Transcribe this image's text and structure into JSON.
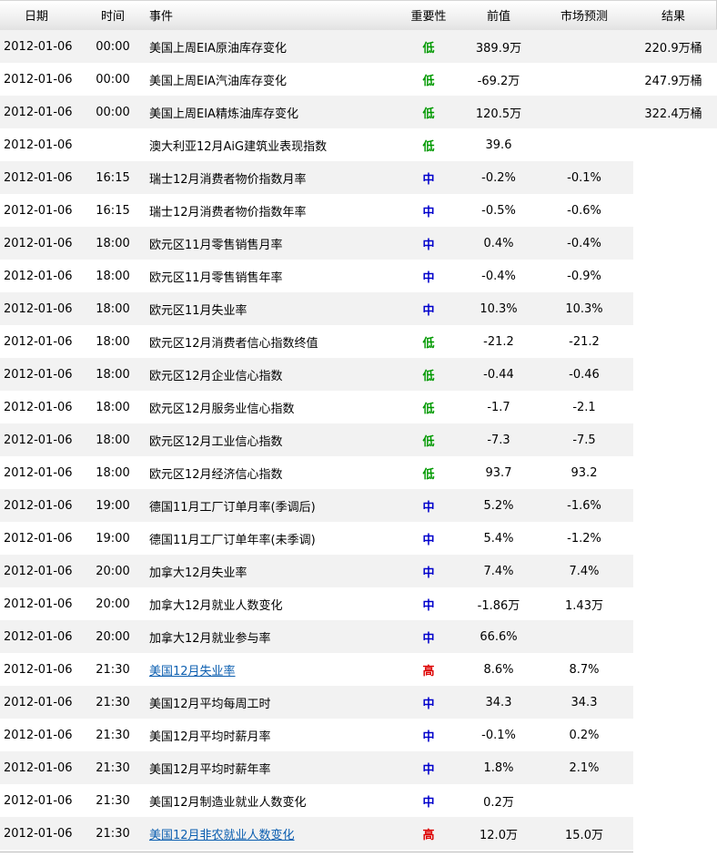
{
  "headers": {
    "date": "日期",
    "time": "时间",
    "event": "事件",
    "importance": "重要性",
    "previous": "前值",
    "forecast": "市场预测",
    "result": "结果"
  },
  "rows": [
    {
      "date": "2012-01-06",
      "time": "00:00",
      "event": "美国上周EIA原油库存变化",
      "importance": "低",
      "level": "low",
      "previous": "389.9万",
      "forecast": "",
      "result": "220.9万桶",
      "link": false
    },
    {
      "date": "2012-01-06",
      "time": "00:00",
      "event": "美国上周EIA汽油库存变化",
      "importance": "低",
      "level": "low",
      "previous": "-69.2万",
      "forecast": "",
      "result": "247.9万桶",
      "link": false
    },
    {
      "date": "2012-01-06",
      "time": "00:00",
      "event": "美国上周EIA精炼油库存变化",
      "importance": "低",
      "level": "low",
      "previous": "120.5万",
      "forecast": "",
      "result": "322.4万桶",
      "link": false
    },
    {
      "date": "2012-01-06",
      "time": "",
      "event": "澳大利亚12月AiG建筑业表现指数",
      "importance": "低",
      "level": "low",
      "previous": "39.6",
      "forecast": "",
      "result": "",
      "link": false
    },
    {
      "date": "2012-01-06",
      "time": "16:15",
      "event": "瑞士12月消费者物价指数月率",
      "importance": "中",
      "level": "mid",
      "previous": "-0.2%",
      "forecast": "-0.1%",
      "result": "",
      "link": false
    },
    {
      "date": "2012-01-06",
      "time": "16:15",
      "event": "瑞士12月消费者物价指数年率",
      "importance": "中",
      "level": "mid",
      "previous": "-0.5%",
      "forecast": "-0.6%",
      "result": "",
      "link": false
    },
    {
      "date": "2012-01-06",
      "time": "18:00",
      "event": "欧元区11月零售销售月率",
      "importance": "中",
      "level": "mid",
      "previous": "0.4%",
      "forecast": "-0.4%",
      "result": "",
      "link": false
    },
    {
      "date": "2012-01-06",
      "time": "18:00",
      "event": "欧元区11月零售销售年率",
      "importance": "中",
      "level": "mid",
      "previous": "-0.4%",
      "forecast": "-0.9%",
      "result": "",
      "link": false
    },
    {
      "date": "2012-01-06",
      "time": "18:00",
      "event": "欧元区11月失业率",
      "importance": "中",
      "level": "mid",
      "previous": "10.3%",
      "forecast": "10.3%",
      "result": "",
      "link": false
    },
    {
      "date": "2012-01-06",
      "time": "18:00",
      "event": "欧元区12月消费者信心指数终值",
      "importance": "低",
      "level": "low",
      "previous": "-21.2",
      "forecast": "-21.2",
      "result": "",
      "link": false
    },
    {
      "date": "2012-01-06",
      "time": "18:00",
      "event": "欧元区12月企业信心指数",
      "importance": "低",
      "level": "low",
      "previous": "-0.44",
      "forecast": "-0.46",
      "result": "",
      "link": false
    },
    {
      "date": "2012-01-06",
      "time": "18:00",
      "event": "欧元区12月服务业信心指数",
      "importance": "低",
      "level": "low",
      "previous": "-1.7",
      "forecast": "-2.1",
      "result": "",
      "link": false
    },
    {
      "date": "2012-01-06",
      "time": "18:00",
      "event": "欧元区12月工业信心指数",
      "importance": "低",
      "level": "low",
      "previous": "-7.3",
      "forecast": "-7.5",
      "result": "",
      "link": false
    },
    {
      "date": "2012-01-06",
      "time": "18:00",
      "event": "欧元区12月经济信心指数",
      "importance": "低",
      "level": "low",
      "previous": "93.7",
      "forecast": "93.2",
      "result": "",
      "link": false
    },
    {
      "date": "2012-01-06",
      "time": "19:00",
      "event": "德国11月工厂订单月率(季调后)",
      "importance": "中",
      "level": "mid",
      "previous": "5.2%",
      "forecast": "-1.6%",
      "result": "",
      "link": false
    },
    {
      "date": "2012-01-06",
      "time": "19:00",
      "event": "德国11月工厂订单年率(未季调)",
      "importance": "中",
      "level": "mid",
      "previous": "5.4%",
      "forecast": "-1.2%",
      "result": "",
      "link": false
    },
    {
      "date": "2012-01-06",
      "time": "20:00",
      "event": "加拿大12月失业率",
      "importance": "中",
      "level": "mid",
      "previous": "7.4%",
      "forecast": "7.4%",
      "result": "",
      "link": false
    },
    {
      "date": "2012-01-06",
      "time": "20:00",
      "event": "加拿大12月就业人数变化",
      "importance": "中",
      "level": "mid",
      "previous": "-1.86万",
      "forecast": "1.43万",
      "result": "",
      "link": false
    },
    {
      "date": "2012-01-06",
      "time": "20:00",
      "event": "加拿大12月就业参与率",
      "importance": "中",
      "level": "mid",
      "previous": "66.6%",
      "forecast": "",
      "result": "",
      "link": false
    },
    {
      "date": "2012-01-06",
      "time": "21:30",
      "event": "美国12月失业率",
      "importance": "高",
      "level": "high",
      "previous": "8.6%",
      "forecast": "8.7%",
      "result": "",
      "link": true
    },
    {
      "date": "2012-01-06",
      "time": "21:30",
      "event": "美国12月平均每周工时",
      "importance": "中",
      "level": "mid",
      "previous": "34.3",
      "forecast": "34.3",
      "result": "",
      "link": false
    },
    {
      "date": "2012-01-06",
      "time": "21:30",
      "event": "美国12月平均时薪月率",
      "importance": "中",
      "level": "mid",
      "previous": "-0.1%",
      "forecast": "0.2%",
      "result": "",
      "link": false
    },
    {
      "date": "2012-01-06",
      "time": "21:30",
      "event": "美国12月平均时薪年率",
      "importance": "中",
      "level": "mid",
      "previous": "1.8%",
      "forecast": "2.1%",
      "result": "",
      "link": false
    },
    {
      "date": "2012-01-06",
      "time": "21:30",
      "event": "美国12月制造业就业人数变化",
      "importance": "中",
      "level": "mid",
      "previous": "0.2万",
      "forecast": "",
      "result": "",
      "link": false
    },
    {
      "date": "2012-01-06",
      "time": "21:30",
      "event": "美国12月非农就业人数变化",
      "importance": "高",
      "level": "high",
      "previous": "12.0万",
      "forecast": "15.0万",
      "result": "",
      "link": true
    }
  ],
  "colors": {
    "low": "#009900",
    "mid": "#0000cc",
    "high": "#dd0000",
    "link": "#0c5fb0",
    "row_alt": "#f2f2f2"
  }
}
